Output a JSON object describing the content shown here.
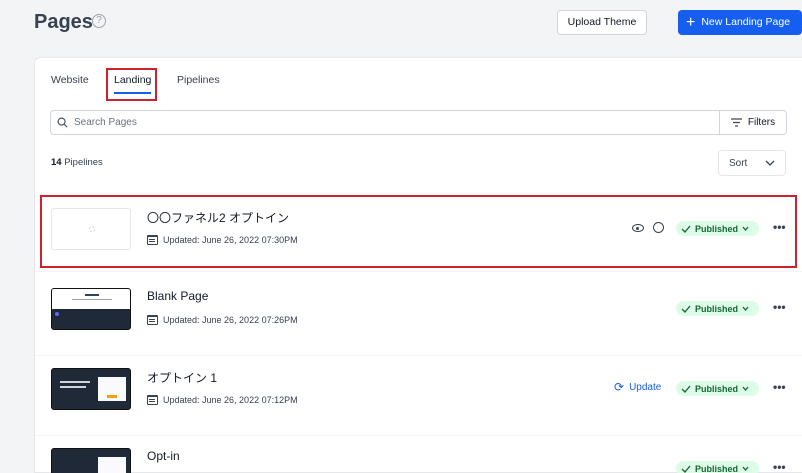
{
  "header": {
    "title": "Pages",
    "help_glyph": "?",
    "upload_label": "Upload Theme",
    "new_label": "New Landing Page"
  },
  "tabs": [
    {
      "label": "Website"
    },
    {
      "label": "Landing"
    },
    {
      "label": "Pipelines"
    }
  ],
  "search": {
    "placeholder": "Search Pages"
  },
  "filters_label": "Filters",
  "count": {
    "number": "14",
    "label": "Pipelines"
  },
  "sort_label": "Sort",
  "rows": [
    {
      "title": "〇〇ファネル2 オプトイン",
      "updated": "Updated: June 26, 2022 07:30PM",
      "status": "Published"
    },
    {
      "title": "Blank Page",
      "updated": "Updated: June 26, 2022 07:26PM",
      "status": "Published"
    },
    {
      "title": "オプトイン 1",
      "updated": "Updated: June 26, 2022 07:12PM",
      "status": "Published",
      "action": "Update"
    },
    {
      "title": "Opt-in",
      "status": "Published"
    }
  ],
  "colors": {
    "accent": "#155eef",
    "published_bg": "#dcfce7",
    "published_fg": "#166534",
    "highlight": "#d0202e"
  }
}
